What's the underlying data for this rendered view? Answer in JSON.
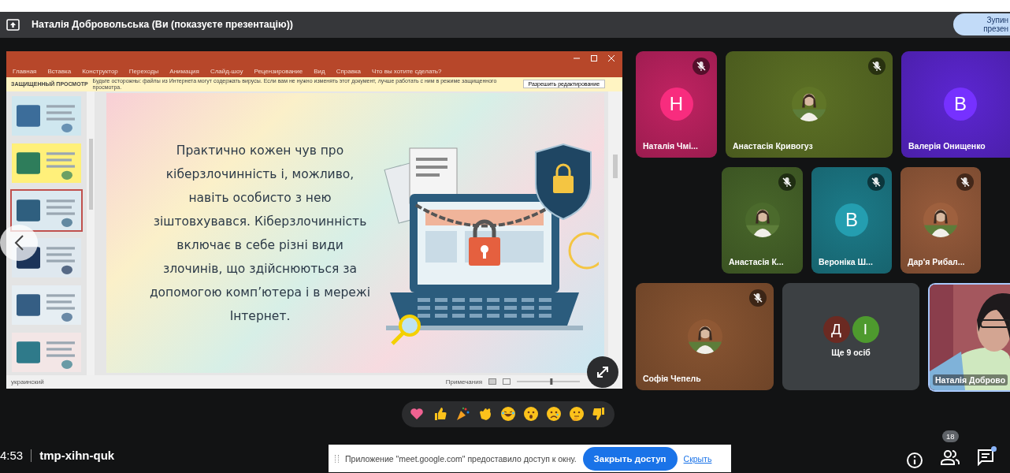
{
  "header": {
    "title": "Наталія Добровольська (Ви (показуєте презентацію))",
    "stop_button": [
      "Зупин",
      "презен"
    ]
  },
  "powerpoint": {
    "ribbon_tabs": [
      "Главная",
      "Вставка",
      "Конструктор",
      "Переходы",
      "Анимация",
      "Слайд-шоу",
      "Рецензирование",
      "Вид",
      "Справка"
    ],
    "search_hint": "Что вы хотите сделать?",
    "protected_view": {
      "label": "ЗАЩИЩЕННЫЙ ПРОСМОТР",
      "message": "Будьте осторожны: файлы из Интернета могут содержать вирусы. Если вам не нужно изменять этот документ, лучше работать с ним в режиме защищенного просмотра.",
      "button": "Разрешить редактирование"
    },
    "thumbnails": [
      {
        "selected": false
      },
      {
        "selected": false
      },
      {
        "selected": true
      },
      {
        "selected": false
      },
      {
        "selected": false
      },
      {
        "selected": false
      }
    ],
    "slide": {
      "text": "Практично кожен чув про\nкіберзлочинність і, можливо,\nнавіть особисто з нею\nзіштовхувався. Кіберзлочинність\nвключає в себе різні види\nзлочинів, що здійснюються за\nдопомогою комп’ютера і в мережі\nІнтернет."
    },
    "status_bar": {
      "language": "украинский",
      "notes": "Примечания",
      "zoom_slider": {
        "level": 0.55
      }
    }
  },
  "participants": [
    {
      "name": "Наталія Чмі...",
      "kind": "initial",
      "initial": "Н",
      "color": "#9b1c4f",
      "muted": true
    },
    {
      "name": "Анастасія Кривогуз",
      "color": "#4a5a1e",
      "muted": true
    },
    {
      "name": "Валерія Онищенко",
      "kind": "initial",
      "initial": "В",
      "color": "#4a1fa8",
      "muted": false
    },
    {
      "name": "Анастасія К...",
      "color": "#3a5222",
      "muted": true
    },
    {
      "name": "Вероніка Ш...",
      "kind": "initial",
      "initial": "В",
      "color": "#17636e",
      "muted": true
    },
    {
      "name": "Дар'я Рибал...",
      "color": "#7a4a30",
      "muted": true
    },
    {
      "name": "Софія Чепель",
      "color": "#6e4428",
      "muted": true
    }
  ],
  "more_tile": {
    "initials": [
      {
        "letter": "Д",
        "color": "#6b2a22"
      },
      {
        "letter": "І",
        "color": "#4e9a2e"
      }
    ],
    "label": "Ще 9 осіб"
  },
  "self_tile": {
    "name": "Наталія Доброво"
  },
  "reactions": [
    {
      "kind": "heart"
    },
    {
      "kind": "thumbs-up"
    },
    {
      "kind": "party"
    },
    {
      "kind": "clap"
    },
    {
      "kind": "laugh"
    },
    {
      "kind": "surprised"
    },
    {
      "kind": "sad"
    },
    {
      "kind": "thinking"
    },
    {
      "kind": "thumbs-down"
    }
  ],
  "bottom_bar": {
    "time": "4:53",
    "meeting_code": "tmp-xihn-quk",
    "participant_count": "18",
    "chat_unread": true
  },
  "share_banner": {
    "message": "Приложение \"meet.google.com\" предоставило доступ к окну.",
    "button": "Закрыть доступ",
    "link": "Скрыть"
  }
}
